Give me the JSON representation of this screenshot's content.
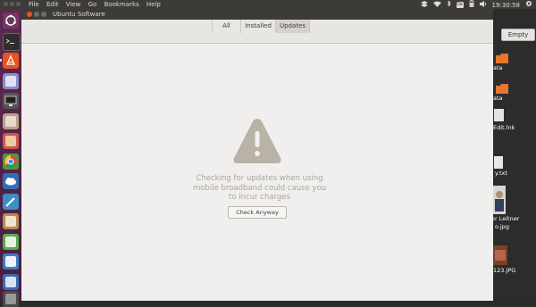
{
  "top_panel": {
    "menus": [
      "File",
      "Edit",
      "View",
      "Go",
      "Bookmarks",
      "Help"
    ],
    "input_badge": "De",
    "clock": "19:30:58"
  },
  "window": {
    "title": "Ubuntu Software",
    "tabs": [
      {
        "label": "All",
        "active": false
      },
      {
        "label": "Installed",
        "active": false
      },
      {
        "label": "Updates",
        "active": true
      }
    ]
  },
  "main": {
    "message": "Checking for updates when using mobile broadband could cause you to incur charges",
    "button_label": "Check Anyway"
  },
  "desktop": {
    "empty_label": "Empty",
    "files": [
      {
        "label": "ata",
        "icon": "folder-icon"
      },
      {
        "label": "ata",
        "icon": "folder-icon"
      },
      {
        "label": "Edit.lnk",
        "icon": "document-icon"
      },
      {
        "label": "y.txt",
        "icon": "text-file-icon"
      },
      {
        "label": "er Leitner",
        "icon": "photo-icon"
      },
      {
        "label": "o.jpg",
        "icon": "photo-icon"
      },
      {
        "label": "123.JPG",
        "icon": "photo-icon"
      }
    ]
  },
  "launcher": {
    "items": [
      "ubuntu-icon",
      "terminal-icon",
      "software-center-icon",
      "files-icon",
      "screen-icon",
      "chat-icon",
      "photos-icon",
      "chrome-icon",
      "cloud-icon",
      "editor-icon",
      "book-icon",
      "spreadsheet-icon",
      "document-icon",
      "blue-icon",
      "disk-icon"
    ]
  },
  "colors": {
    "accent": "#e95420",
    "panel": "#3c3b37",
    "launcher": "#5e2750",
    "warning_icon": "#b8b2a7"
  }
}
